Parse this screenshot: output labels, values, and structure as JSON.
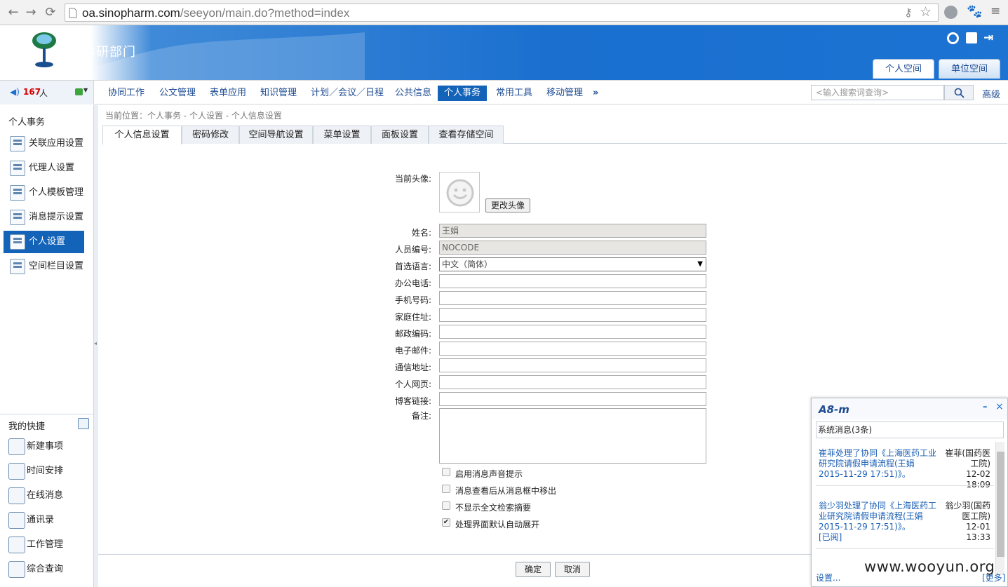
{
  "browser": {
    "url_host": "oa.sinopharm.com",
    "url_path": "/seeyon/main.do?method=index"
  },
  "header": {
    "department": "科研部门",
    "space_tabs": [
      "个人空间",
      "单位空间"
    ]
  },
  "menubar": {
    "online_count": "167",
    "online_suffix": "人",
    "items": [
      "协同工作",
      "公文管理",
      "表单应用",
      "知识管理",
      "计划／会议／日程",
      "公共信息",
      "个人事务",
      "常用工具",
      "移动管理"
    ],
    "more": "»",
    "search_placeholder": "<输入搜索词查询>",
    "advanced": "高级"
  },
  "sidebar": {
    "title": "个人事务",
    "items": [
      "关联应用设置",
      "代理人设置",
      "个人模板管理",
      "消息提示设置",
      "个人设置",
      "空间栏目设置"
    ],
    "active_index": 4,
    "quick_title": "我的快捷",
    "quick_items": [
      "新建事项",
      "时间安排",
      "在线消息",
      "通讯录",
      "工作管理",
      "综合查询"
    ]
  },
  "content": {
    "breadcrumb": "当前位置：个人事务 - 个人设置 - 个人信息设置",
    "tabs": [
      "个人信息设置",
      "密码修改",
      "空间导航设置",
      "菜单设置",
      "面板设置",
      "查看存储空间"
    ],
    "form": {
      "avatar_label": "当前头像:",
      "avatar_button": "更改头像",
      "fields": [
        {
          "label": "姓名:",
          "value": ""
        },
        {
          "label": "人员编号:",
          "value": "NOCODE"
        },
        {
          "label": "首选语言:",
          "value": "中文（简体）"
        },
        {
          "label": "办公电话:",
          "value": ""
        },
        {
          "label": "手机号码:",
          "value": ""
        },
        {
          "label": "家庭住址:",
          "value": ""
        },
        {
          "label": "邮政编码:",
          "value": ""
        },
        {
          "label": "电子邮件:",
          "value": ""
        },
        {
          "label": "通信地址:",
          "value": ""
        },
        {
          "label": "个人网页:",
          "value": ""
        },
        {
          "label": "博客链接:",
          "value": ""
        }
      ],
      "name_value": "王娟",
      "notes_label": "备注:",
      "checkboxes": [
        {
          "label": "启用消息声音提示",
          "checked": false
        },
        {
          "label": "消息查看后从消息框中移出",
          "checked": false
        },
        {
          "label": "不显示全文检索摘要",
          "checked": false
        },
        {
          "label": "处理界面默认自动展开",
          "checked": true
        }
      ],
      "ok_button": "确定",
      "cancel_button": "取消"
    }
  },
  "popup": {
    "logo": "A8-m",
    "header": "系统消息(3条)",
    "messages": [
      {
        "text": "崔菲处理了协同《上海医药工业研究院请假申请流程(王娟 2015-11-29 17:51)》。",
        "sender": "崔菲(国药医工院)",
        "time": "12-02 18:09",
        "status": ""
      },
      {
        "text": "翁少羽处理了协同《上海医药工业研究院请假申请流程(王娟 2015-11-29 17:51)》。",
        "sender": "翁少羽(国药医工院)",
        "time": "12-01 13:33",
        "status": "[已阅]"
      }
    ],
    "settings": "设置...",
    "more": "[更多]"
  },
  "watermark": "www.wooyun.org"
}
